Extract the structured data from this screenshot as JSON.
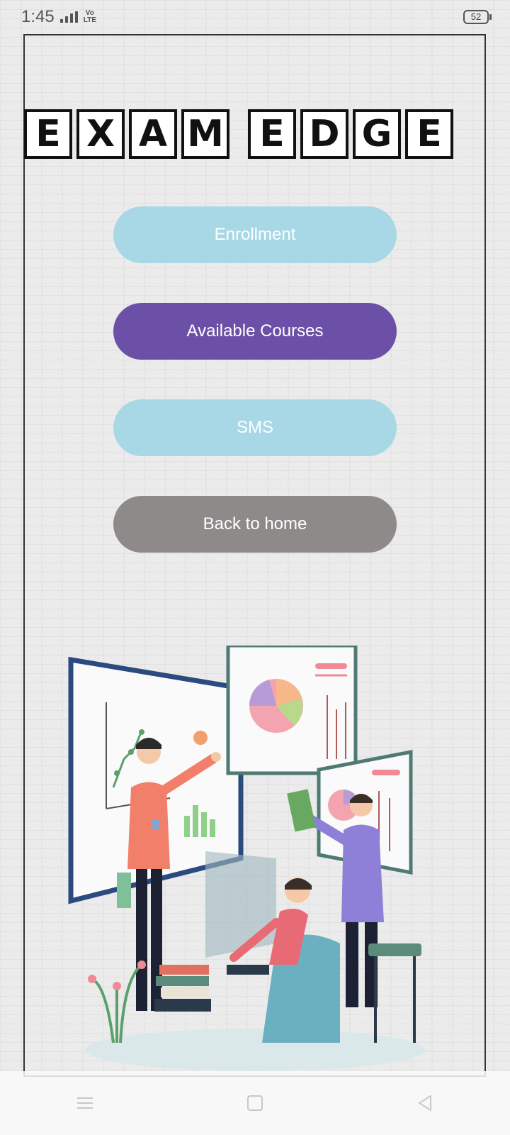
{
  "status_bar": {
    "time": "1:45",
    "network_label_top": "Vo",
    "network_label_bottom": "LTE",
    "battery": "52"
  },
  "app": {
    "title_words": [
      [
        "E",
        "X",
        "A",
        "M"
      ],
      [
        "E",
        "D",
        "G",
        "E"
      ]
    ]
  },
  "menu": {
    "enrollment_label": "Enrollment",
    "courses_label": "Available Courses",
    "sms_label": "SMS",
    "home_label": "Back to home"
  },
  "colors": {
    "button_light_blue": "#a8d8e6",
    "button_purple": "#6c4fa6",
    "button_gray": "#8e8a8a"
  },
  "illustration": {
    "icon": "classroom-presentation-illustration"
  },
  "navbar": {
    "icons": [
      "menu-icon",
      "home-square-icon",
      "back-triangle-icon"
    ]
  }
}
